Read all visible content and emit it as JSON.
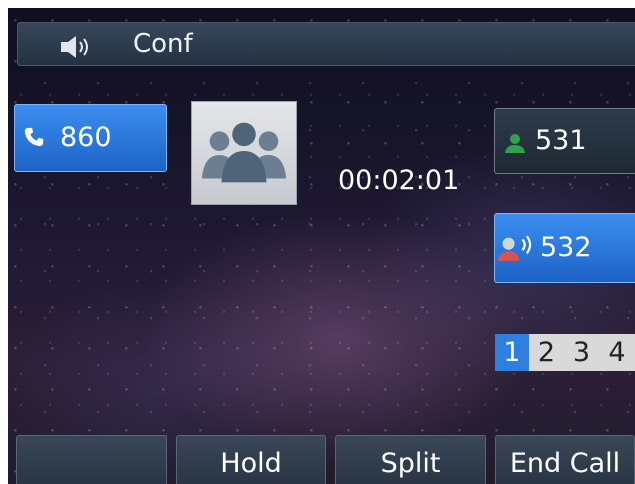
{
  "header": {
    "title": "Conf",
    "icon": "speaker-icon"
  },
  "lines": [
    {
      "label": "860",
      "icon": "phone-handset-icon",
      "state": "active",
      "color": "#2f7fe0"
    },
    {
      "label": "531",
      "icon": "contact-green-icon",
      "state": "idle",
      "color": "#2fa24a"
    },
    {
      "label": "532",
      "icon": "contact-speaking-red-icon",
      "state": "active",
      "color": "#d9534f"
    }
  ],
  "call": {
    "timer": "00:02:01",
    "avatar_icon": "conference-group-icon"
  },
  "pages": {
    "items": [
      "1",
      "2",
      "3",
      "4"
    ],
    "current": "1"
  },
  "softkeys": [
    {
      "label": ""
    },
    {
      "label": "Hold"
    },
    {
      "label": "Split"
    },
    {
      "label": "End Call"
    }
  ],
  "colors": {
    "accent": "#2f7fe0",
    "title_bar": "#2d3c4d"
  }
}
